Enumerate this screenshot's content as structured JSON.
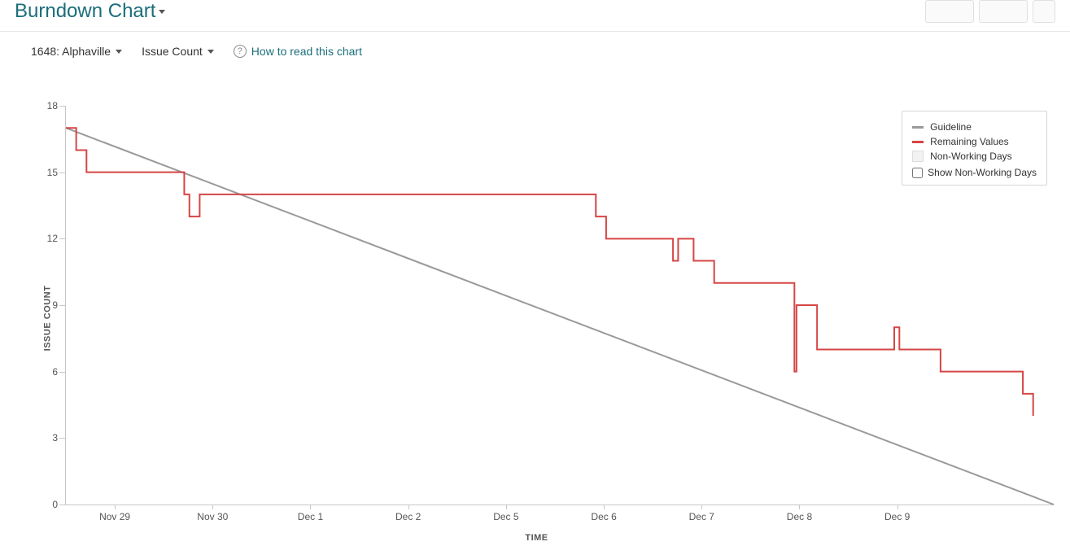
{
  "header": {
    "title": "Burndown Chart"
  },
  "controls": {
    "sprint_dropdown": "1648: Alphaville",
    "metric_dropdown": "Issue Count",
    "help_link": "How to read this chart"
  },
  "legend": {
    "guideline": "Guideline",
    "remaining": "Remaining Values",
    "nonworking": "Non-Working Days",
    "toggle_label": "Show Non-Working Days"
  },
  "axes": {
    "y_title": "ISSUE COUNT",
    "x_title": "TIME"
  },
  "chart_data": {
    "type": "line",
    "x_ticks": [
      "Nov 29",
      "Nov 30",
      "Dec 1",
      "Dec 2",
      "Dec 5",
      "Dec 6",
      "Dec 7",
      "Dec 8",
      "Dec 9"
    ],
    "y_ticks": [
      0,
      3,
      6,
      9,
      12,
      15,
      18
    ],
    "ylim": [
      0,
      18
    ],
    "x_range_days": 9.6,
    "ylabel": "ISSUE COUNT",
    "xlabel": "TIME",
    "series": [
      {
        "name": "Guideline",
        "style": "line",
        "color": "#9a9a9a",
        "points": [
          {
            "x": 0.0,
            "y": 17
          },
          {
            "x": 9.6,
            "y": 0
          }
        ]
      },
      {
        "name": "Remaining Values",
        "style": "step",
        "color": "#d64545",
        "points": [
          {
            "x": 0.0,
            "y": 17
          },
          {
            "x": 0.1,
            "y": 16
          },
          {
            "x": 0.2,
            "y": 15
          },
          {
            "x": 1.1,
            "y": 15
          },
          {
            "x": 1.15,
            "y": 14
          },
          {
            "x": 1.2,
            "y": 13
          },
          {
            "x": 1.3,
            "y": 13
          },
          {
            "x": 1.3,
            "y": 14
          },
          {
            "x": 5.1,
            "y": 14
          },
          {
            "x": 5.15,
            "y": 13
          },
          {
            "x": 5.25,
            "y": 12
          },
          {
            "x": 5.85,
            "y": 12
          },
          {
            "x": 5.9,
            "y": 11
          },
          {
            "x": 5.95,
            "y": 12
          },
          {
            "x": 6.05,
            "y": 12
          },
          {
            "x": 6.1,
            "y": 11
          },
          {
            "x": 6.3,
            "y": 11
          },
          {
            "x": 6.3,
            "y": 10
          },
          {
            "x": 7.05,
            "y": 10
          },
          {
            "x": 7.08,
            "y": 6
          },
          {
            "x": 7.1,
            "y": 9
          },
          {
            "x": 7.25,
            "y": 9
          },
          {
            "x": 7.3,
            "y": 7
          },
          {
            "x": 8.0,
            "y": 7
          },
          {
            "x": 8.05,
            "y": 8
          },
          {
            "x": 8.1,
            "y": 7
          },
          {
            "x": 8.45,
            "y": 7
          },
          {
            "x": 8.5,
            "y": 6
          },
          {
            "x": 9.25,
            "y": 6
          },
          {
            "x": 9.3,
            "y": 5
          },
          {
            "x": 9.4,
            "y": 5
          },
          {
            "x": 9.4,
            "y": 4
          }
        ]
      }
    ]
  }
}
